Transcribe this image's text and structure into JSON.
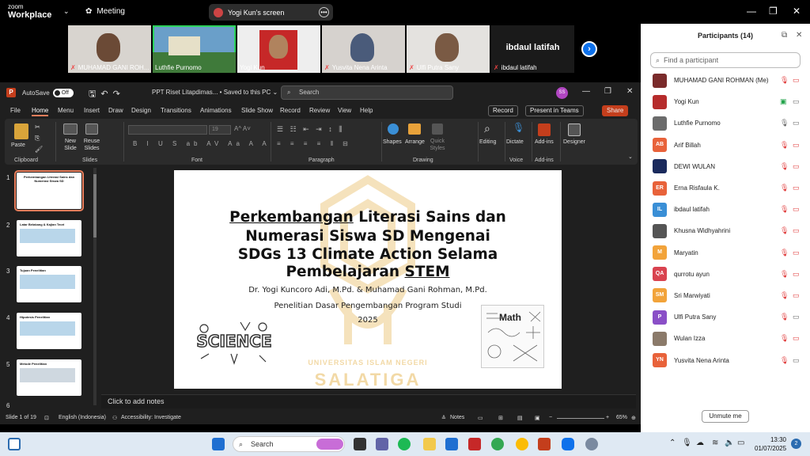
{
  "zoom": {
    "logo_top": "zoom",
    "logo_bottom": "Workplace",
    "meeting_label": "Meeting",
    "screen_label": "Yogi Kun's screen"
  },
  "video_tiles": [
    {
      "name": "MUHAMAD GANI ROH...",
      "muted": true
    },
    {
      "name": "Luthfie Purnomo",
      "muted": false,
      "active": true
    },
    {
      "name": "Yogi Kun",
      "muted": false
    },
    {
      "name": "Yusvita Nena Arinta",
      "muted": true
    },
    {
      "name": "Ulfi Putra Sany",
      "muted": true
    },
    {
      "name": "ibdaul latifah",
      "muted": true,
      "big_label": "ibdaul latifah"
    }
  ],
  "participants": {
    "title": "Participants (14)",
    "search_placeholder": "Find a participant",
    "unmute_label": "Unmute me",
    "list": [
      {
        "name": "MUHAMAD GANI ROHMAN (Me)",
        "initials": "",
        "color": "#7a2b2b",
        "mic": "muted",
        "cam": "off"
      },
      {
        "name": "Yogi Kun",
        "initials": "",
        "color": "#b62c2c",
        "mic": "share",
        "cam": "on"
      },
      {
        "name": "Luthfie Purnomo",
        "initials": "",
        "color": "#6b6b6b",
        "mic": "on",
        "cam": "on"
      },
      {
        "name": "Arif Billah",
        "initials": "AB",
        "color": "#e8623a",
        "mic": "muted",
        "cam": "off"
      },
      {
        "name": "DEWI WULAN",
        "initials": "",
        "color": "#1a2a5c",
        "mic": "muted",
        "cam": "off"
      },
      {
        "name": "Erna Risfaula K.",
        "initials": "ER",
        "color": "#e8623a",
        "mic": "muted",
        "cam": "off"
      },
      {
        "name": "ibdaul latifah",
        "initials": "IL",
        "color": "#3a8fd6",
        "mic": "muted",
        "cam": "off"
      },
      {
        "name": "Khusna Widhyahrini",
        "initials": "",
        "color": "#555555",
        "mic": "muted",
        "cam": "off"
      },
      {
        "name": "Maryatin",
        "initials": "M",
        "color": "#f2a33a",
        "mic": "muted",
        "cam": "off"
      },
      {
        "name": "qurrotu ayun",
        "initials": "QA",
        "color": "#d9434f",
        "mic": "muted",
        "cam": "off"
      },
      {
        "name": "Sri Marwiyati",
        "initials": "SM",
        "color": "#f2a33a",
        "mic": "muted",
        "cam": "off"
      },
      {
        "name": "Ulfi Putra Sany",
        "initials": "P",
        "color": "#8a4fc7",
        "mic": "muted",
        "cam": "on"
      },
      {
        "name": "Wulan Izza",
        "initials": "",
        "color": "#8b7a6a",
        "mic": "muted",
        "cam": "off"
      },
      {
        "name": "Yusvita Nena Arinta",
        "initials": "YN",
        "color": "#e8623a",
        "mic": "muted",
        "cam": "on"
      }
    ]
  },
  "ppt": {
    "autosave": "AutoSave",
    "toggle": "Off",
    "doc_title": "PPT Riset Litapdimas... • Saved to this PC ⌄",
    "search": "Search",
    "avatar": "SS",
    "menu": [
      "File",
      "Home",
      "Menu",
      "Insert",
      "Draw",
      "Design",
      "Transitions",
      "Animations",
      "Slide Show",
      "Record",
      "Review",
      "View",
      "Help"
    ],
    "record": "Record",
    "present": "Present in Teams",
    "share": "Share",
    "ribbon": {
      "paste": "Paste",
      "new_slide": "New Slide",
      "reuse": "Reuse Slides",
      "clipboard": "Clipboard",
      "slides": "Slides",
      "font": "Font",
      "font_size": "19",
      "paragraph": "Paragraph",
      "shapes": "Shapes",
      "arrange": "Arrange",
      "quick_styles": "Quick Styles",
      "drawing": "Drawing",
      "editing": "Editing",
      "dictate": "Dictate",
      "voice": "Voice",
      "addins": "Add-ins",
      "addins_grp": "Add-ins",
      "designer": "Designer"
    },
    "thumbs": [
      {
        "num": "1",
        "title": "Perkembangan Literasi Sains dan Numerasi Siswa SD",
        "selected": true
      },
      {
        "num": "2",
        "title": "Latar Belakang & Kajian Teori"
      },
      {
        "num": "3",
        "title": "Tujuan Penelitian"
      },
      {
        "num": "4",
        "title": "Hipotesis Penelitian"
      },
      {
        "num": "5",
        "title": "Metode Penelitian"
      },
      {
        "num": "6",
        "title": ""
      }
    ],
    "notes": "Click to add notes",
    "status": {
      "slide": "Slide 1 of 19",
      "lang": "English (Indonesia)",
      "access": "Accessibility: Investigate",
      "notes_btn": "Notes",
      "zoom": "65%"
    }
  },
  "slide": {
    "title_l1_u": "Perkembangan",
    "title_l1_rest": " Literasi Sains dan",
    "title_l2": "Numerasi Siswa SD Mengenai",
    "title_l3": "SDGs 13 Climate Action Selama",
    "title_l4_a": "Pembelajaran ",
    "title_l4_u": "STEM",
    "authors": "Dr. Yogi Kuncoro Adi, M.Pd. & Muhamad Gani Rohman, M.Pd.",
    "subtitle": "Penelitian Dasar Pengembangan Program Studi",
    "year": "2025",
    "wm_top": "UNIVERSITAS ISLAM NEGERI",
    "wm_bottom": "SALATIGA",
    "science": "SCIENCE",
    "math": "Math"
  },
  "taskbar": {
    "search": "Search",
    "time": "13:30",
    "date": "01/07/2025",
    "notif": "2"
  }
}
